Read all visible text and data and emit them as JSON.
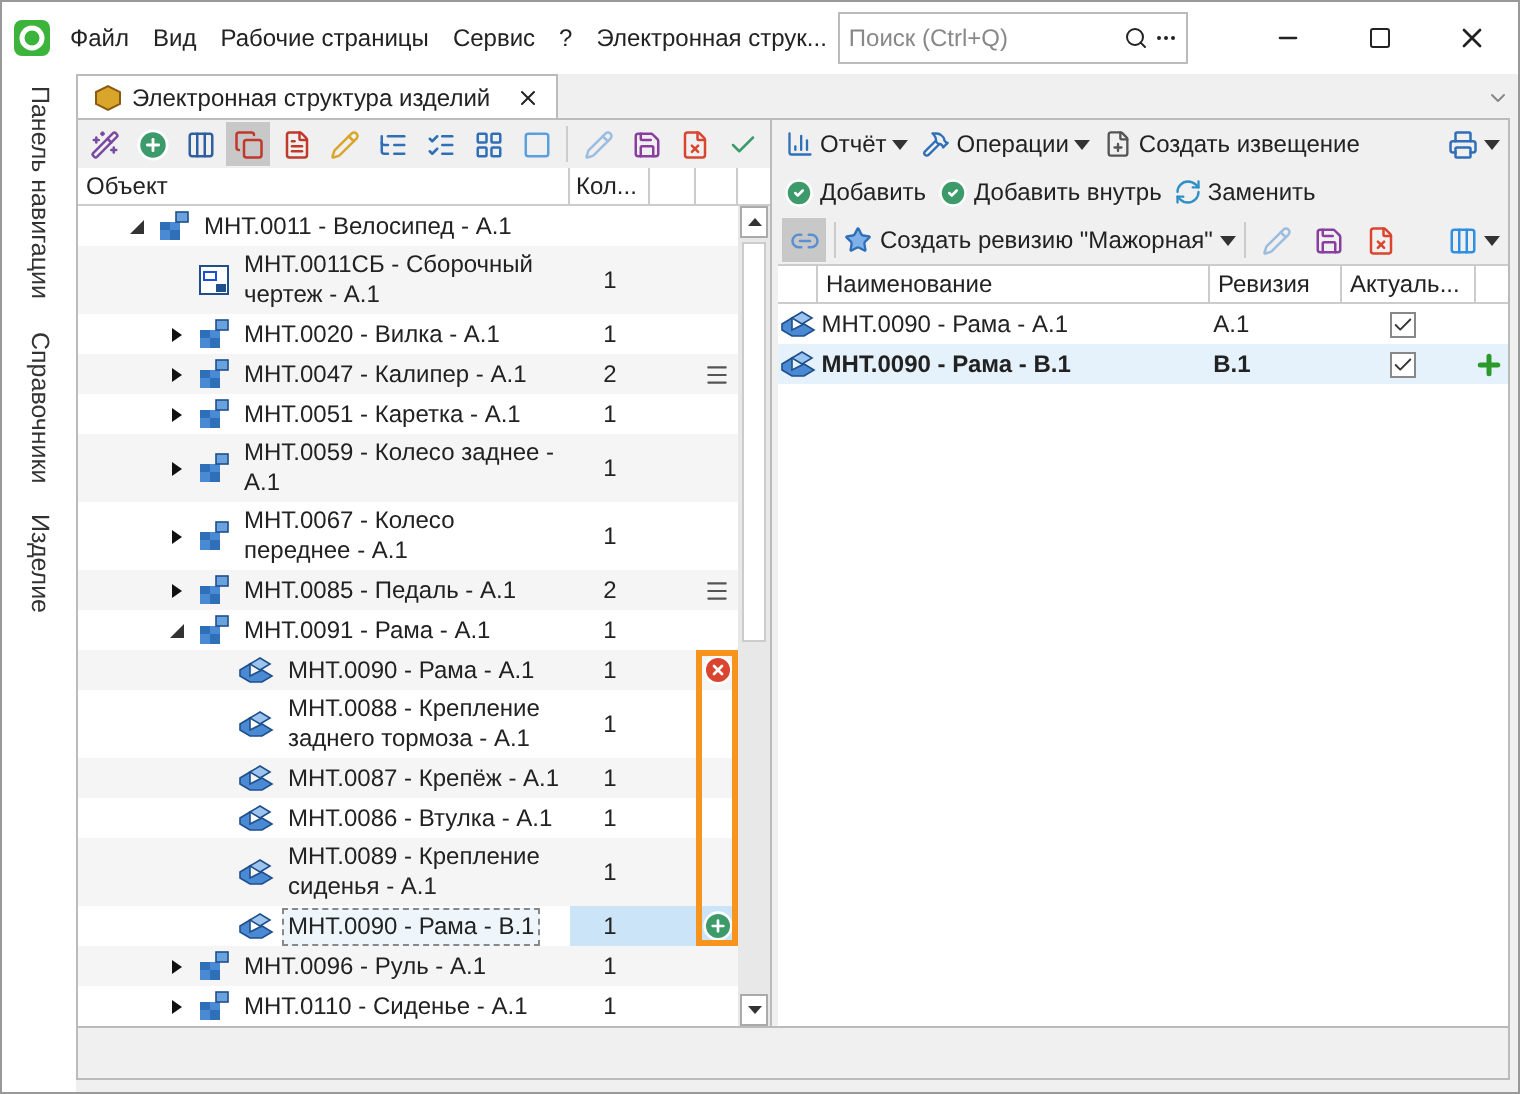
{
  "menu": [
    "Файл",
    "Вид",
    "Рабочие страницы",
    "Сервис",
    "?"
  ],
  "window": {
    "title": "Электронная струк..."
  },
  "search": {
    "placeholder": "Поиск (Ctrl+Q)"
  },
  "side_tabs": [
    "Панель навигации",
    "Справочники",
    "Изделие"
  ],
  "doc_tab": {
    "label": "Электронная структура изделий",
    "selected": true
  },
  "tree": {
    "columns": [
      "Объект",
      "Кол..."
    ],
    "items": [
      {
        "kind": "assembly",
        "name": "МНТ.0011 - Велосипед - А.1",
        "expanded": true,
        "selected": false,
        "children": [
          {
            "kind": "drawing",
            "name": "МНТ.0011СБ - Сборочный чертеж - А.1",
            "qty": "1",
            "selected": false
          },
          {
            "kind": "assembly",
            "name": "МНТ.0020 - Вилка - А.1",
            "qty": "1",
            "expanded": false,
            "selected": false
          },
          {
            "kind": "assembly",
            "name": "МНТ.0047 - Калипер - А.1",
            "qty": "2",
            "marker": {
              "kind": "list"
            },
            "expanded": false,
            "selected": false
          },
          {
            "kind": "assembly",
            "name": "МНТ.0051 - Каретка - А.1",
            "qty": "1",
            "expanded": false,
            "selected": false
          },
          {
            "kind": "assembly",
            "name": "МНТ.0059 - Колесо заднее - А.1",
            "qty": "1",
            "expanded": false,
            "selected": false
          },
          {
            "kind": "assembly",
            "name": "МНТ.0067 - Колесо переднее - А.1",
            "qty": "1",
            "expanded": false,
            "selected": false
          },
          {
            "kind": "assembly",
            "name": "МНТ.0085 - Педаль - А.1",
            "qty": "2",
            "marker": {
              "kind": "list"
            },
            "expanded": false,
            "selected": false
          },
          {
            "kind": "assembly",
            "name": "МНТ.0091 - Рама - А.1",
            "qty": "1",
            "expanded": true,
            "framed": true,
            "selected": false,
            "children": [
              {
                "kind": "part",
                "name": "МНТ.0090 - Рама - А.1",
                "qty": "1",
                "marker": {
                  "kind": "removed"
                },
                "selected": false
              },
              {
                "kind": "part",
                "name": "МНТ.0088 - Крепление заднего тормоза - А.1",
                "qty": "1",
                "selected": false
              },
              {
                "kind": "part",
                "name": "МНТ.0087 - Крепёж - А.1",
                "qty": "1",
                "selected": false
              },
              {
                "kind": "part",
                "name": "МНТ.0086 - Втулка - А.1",
                "qty": "1",
                "selected": false
              },
              {
                "kind": "part",
                "name": "МНТ.0089 - Крепление сиденья - А.1",
                "qty": "1",
                "selected": false
              },
              {
                "kind": "part",
                "name": "МНТ.0090 - Рама - В.1",
                "qty": "1",
                "marker": {
                  "kind": "added"
                },
                "selected": true
              }
            ]
          },
          {
            "kind": "assembly",
            "name": "МНТ.0096 - Руль - А.1",
            "qty": "1",
            "expanded": false,
            "selected": false
          },
          {
            "kind": "assembly",
            "name": "МНТ.0110 - Сиденье - А.1",
            "qty": "1",
            "expanded": false,
            "selected": false
          }
        ]
      }
    ]
  },
  "right_toolbar1": [
    "Отчёт",
    "Операции",
    "Создать извещение"
  ],
  "right_toolbar2": [
    "Добавить",
    "Добавить внутрь",
    "Заменить"
  ],
  "link_toggle": {
    "on": true
  },
  "create_revision": "Создать ревизию \"Мажорная\"",
  "revisions": {
    "columns": [
      "Наименование",
      "Ревизия",
      "Актуаль..."
    ],
    "rows": [
      {
        "name": "МНТ.0090 - Рама - А.1",
        "revision": "А.1",
        "current": true,
        "added": false,
        "selected": false
      },
      {
        "name": "МНТ.0090 - Рама - В.1",
        "revision": "В.1",
        "current": true,
        "added": true,
        "selected": true
      }
    ]
  }
}
